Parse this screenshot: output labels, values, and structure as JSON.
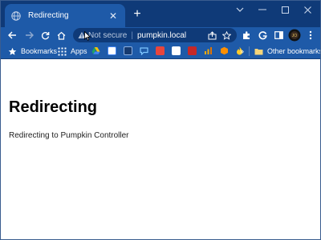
{
  "browser": {
    "tab": {
      "title": "Redirecting",
      "favicon": "globe-icon",
      "close": "✕"
    },
    "new_tab": "+",
    "window_controls": [
      "chevron-down-icon",
      "minimize-icon",
      "maximize-icon",
      "close-icon"
    ]
  },
  "toolbar": {
    "buttons": [
      "back-icon",
      "forward-icon",
      "reload-icon",
      "home-icon"
    ],
    "omnibox": {
      "security_label": "Not secure",
      "separator": "|",
      "url": "pumpkin.local"
    },
    "right_buttons": [
      "extensions-icon",
      "g-icon",
      "side-panel-icon",
      "profile-avatar",
      "more-icon"
    ]
  },
  "bookmarks": {
    "items": [
      {
        "label": "Bookmarks",
        "icon": "star-icon"
      },
      {
        "label": "Apps",
        "icon": "apps-grid-icon"
      }
    ],
    "overflow": "»",
    "other": {
      "label": "Other bookmarks",
      "icon": "folder-icon"
    }
  },
  "page": {
    "heading": "Redirecting",
    "body": "Redirecting to Pumpkin Controller"
  },
  "colors": {
    "tabstrip": "#0f3a78",
    "toolbar": "#1e5aa8",
    "page_bg": "#ffffff"
  }
}
